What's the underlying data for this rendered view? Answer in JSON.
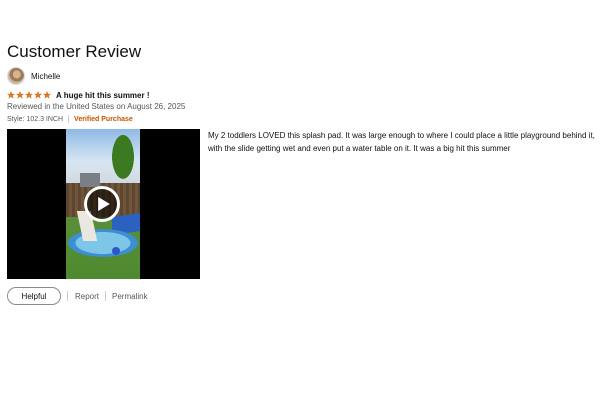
{
  "page": {
    "title": "Customer Review"
  },
  "review": {
    "author": "Michelle",
    "rating": 5,
    "rating_max": 5,
    "headline": "A huge hit this summer !",
    "reviewed_line": "Reviewed in the United States on August 26, 2025",
    "style": "Style: 102.3 INCH",
    "verified": "Verified Purchase",
    "body": "My 2 toddlers LOVED this splash pad. It was large enough to where I could place a little playground behind it, with the slide getting wet and even put a water table on it. It was a big hit this summer",
    "media": {
      "type": "video",
      "play_icon": "play-icon"
    }
  },
  "actions": {
    "helpful_label": "Helpful",
    "report_label": "Report",
    "permalink_label": "Permalink"
  },
  "colors": {
    "star": "#de7921",
    "verified": "#c45500",
    "secondary_text": "#565959"
  }
}
